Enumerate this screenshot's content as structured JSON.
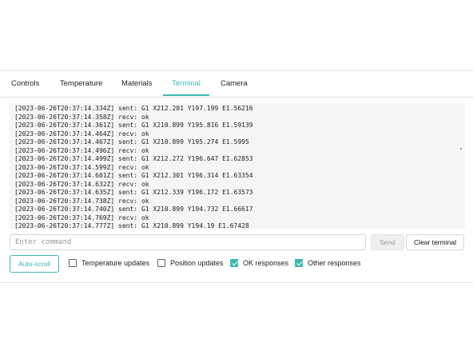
{
  "tabs": [
    {
      "label": "Controls",
      "active": false
    },
    {
      "label": "Temperature",
      "active": false
    },
    {
      "label": "Materials",
      "active": false
    },
    {
      "label": "Terminal",
      "active": true
    },
    {
      "label": "Camera",
      "active": false
    }
  ],
  "terminal": {
    "lines": [
      "[2023-06-26T20:37:14.334Z] sent: G1 X212.281 Y197.199 E1.56216",
      "[2023-06-26T20:37:14.358Z] recv: ok",
      "[2023-06-26T20:37:14.361Z] sent: G1 X210.899 Y195.816 E1.59139",
      "[2023-06-26T20:37:14.464Z] recv: ok",
      "[2023-06-26T20:37:14.467Z] sent: G1 X210.899 Y195.274 E1.5995",
      "[2023-06-26T20:37:14.496Z] recv: ok",
      "[2023-06-26T20:37:14.499Z] sent: G1 X212.272 Y196.647 E1.62853",
      "[2023-06-26T20:37:14.599Z] recv: ok",
      "[2023-06-26T20:37:14.601Z] sent: G1 X212.301 Y196.314 E1.63354",
      "[2023-06-26T20:37:14.632Z] recv: ok",
      "[2023-06-26T20:37:14.635Z] sent: G1 X212.339 Y196.172 E1.63573",
      "[2023-06-26T20:37:14.738Z] recv: ok",
      "[2023-06-26T20:37:14.740Z] sent: G1 X210.899 Y194.732 E1.66617",
      "[2023-06-26T20:37:14.769Z] recv: ok",
      "[2023-06-26T20:37:14.777Z] sent: G1 X210.899 Y194.19 E1.67428"
    ]
  },
  "command": {
    "placeholder": "Enter command",
    "value": ""
  },
  "buttons": {
    "send": "Send",
    "clear": "Clear terminal",
    "autoscroll": "Auto-scroll"
  },
  "options": [
    {
      "label": "Temperature updates",
      "checked": false
    },
    {
      "label": "Position updates",
      "checked": false
    },
    {
      "label": "OK responses",
      "checked": true
    },
    {
      "label": "Other responses",
      "checked": true
    }
  ],
  "colors": {
    "accent": "#3fb8b4"
  }
}
